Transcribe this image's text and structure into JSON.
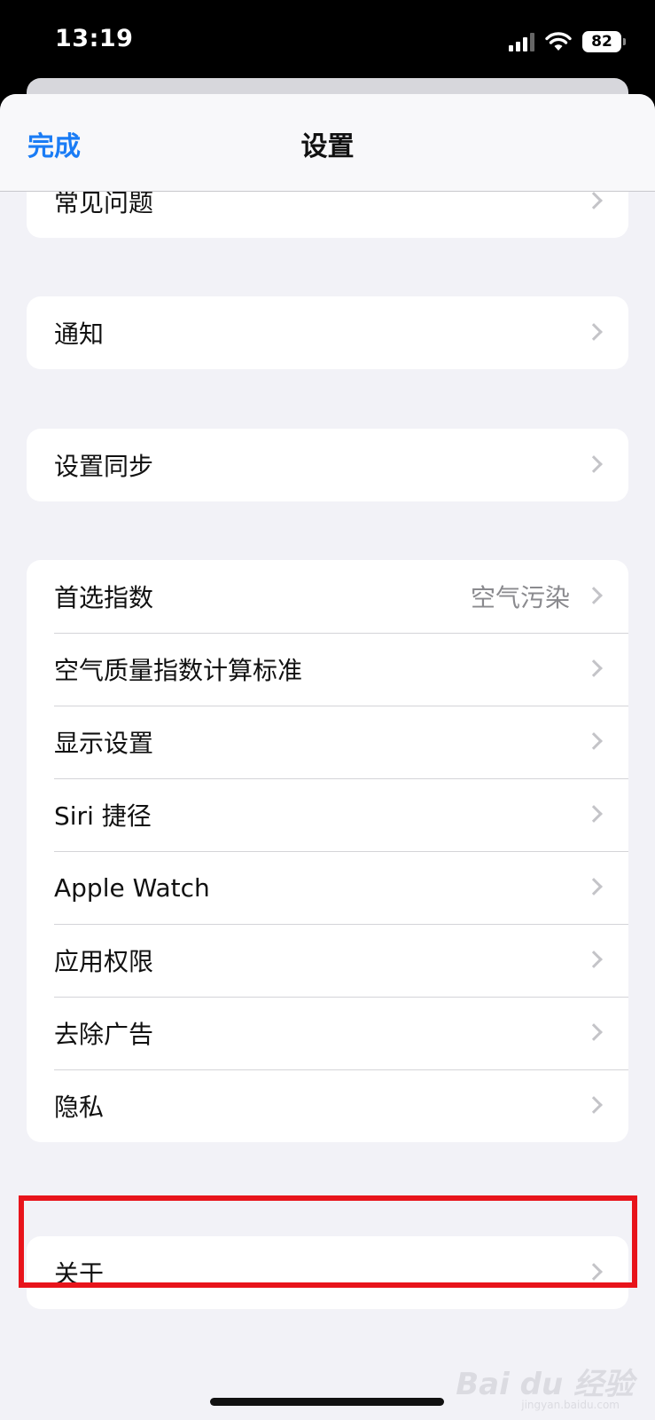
{
  "status_bar": {
    "time": "13:19",
    "battery": "82",
    "icons": [
      "signal-icon",
      "wifi-icon",
      "battery-icon"
    ]
  },
  "nav": {
    "done_label": "完成",
    "title": "设置"
  },
  "groups": [
    {
      "items": [
        {
          "label": "常见问题"
        }
      ]
    },
    {
      "items": [
        {
          "label": "通知"
        }
      ]
    },
    {
      "items": [
        {
          "label": "设置同步"
        }
      ]
    },
    {
      "items": [
        {
          "label": "首选指数",
          "value": "空气污染"
        },
        {
          "label": "空气质量指数计算标准"
        },
        {
          "label": "显示设置"
        },
        {
          "label": "Siri 捷径"
        },
        {
          "label": "Apple Watch"
        },
        {
          "label": "应用权限"
        },
        {
          "label": "去除广告"
        },
        {
          "label": "隐私"
        }
      ]
    },
    {
      "items": [
        {
          "label": "关于"
        }
      ]
    }
  ],
  "watermark": {
    "text": "Bai du 经验",
    "sub": "jingyan.baidu.com"
  },
  "colors": {
    "accent": "#1a7cf5",
    "highlight": "#e8141b",
    "background": "#f2f2f7"
  }
}
